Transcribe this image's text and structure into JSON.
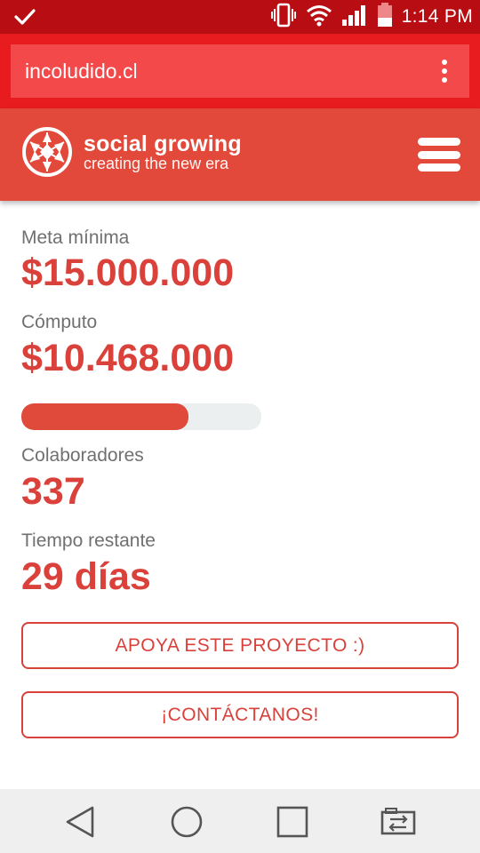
{
  "status_bar": {
    "time": "1:14 PM",
    "icons": [
      "check-icon",
      "vibrate-icon",
      "wifi-icon",
      "signal-icon",
      "battery-icon"
    ]
  },
  "browser": {
    "url": "incoludido.cl",
    "menu_icon": "more-vert-icon"
  },
  "header": {
    "logo_title": "social growing",
    "logo_subtitle": "creating the new era",
    "menu_icon": "hamburger-icon"
  },
  "stats": {
    "goal_label": "Meta mínima",
    "goal_value": "$15.000.000",
    "raised_label": "Cómputo",
    "raised_value": "$10.468.000",
    "progress_fraction": 0.698,
    "backers_label": "Colaboradores",
    "backers_value": "337",
    "time_label": "Tiempo restante",
    "time_value": "29 días"
  },
  "actions": {
    "support_label": "APOYA ESTE PROYECTO :)",
    "contact_label": "¡CONTÁCTANOS!"
  },
  "nav": {
    "icons": [
      "back-icon",
      "home-icon",
      "recents-icon",
      "switch-app-icon"
    ]
  },
  "colors": {
    "status_bar": "#b80d12",
    "browser_bar": "#e81c1e",
    "brand": "#e2493a",
    "accent_text": "#d9413a",
    "progress_track": "#ecefef"
  }
}
